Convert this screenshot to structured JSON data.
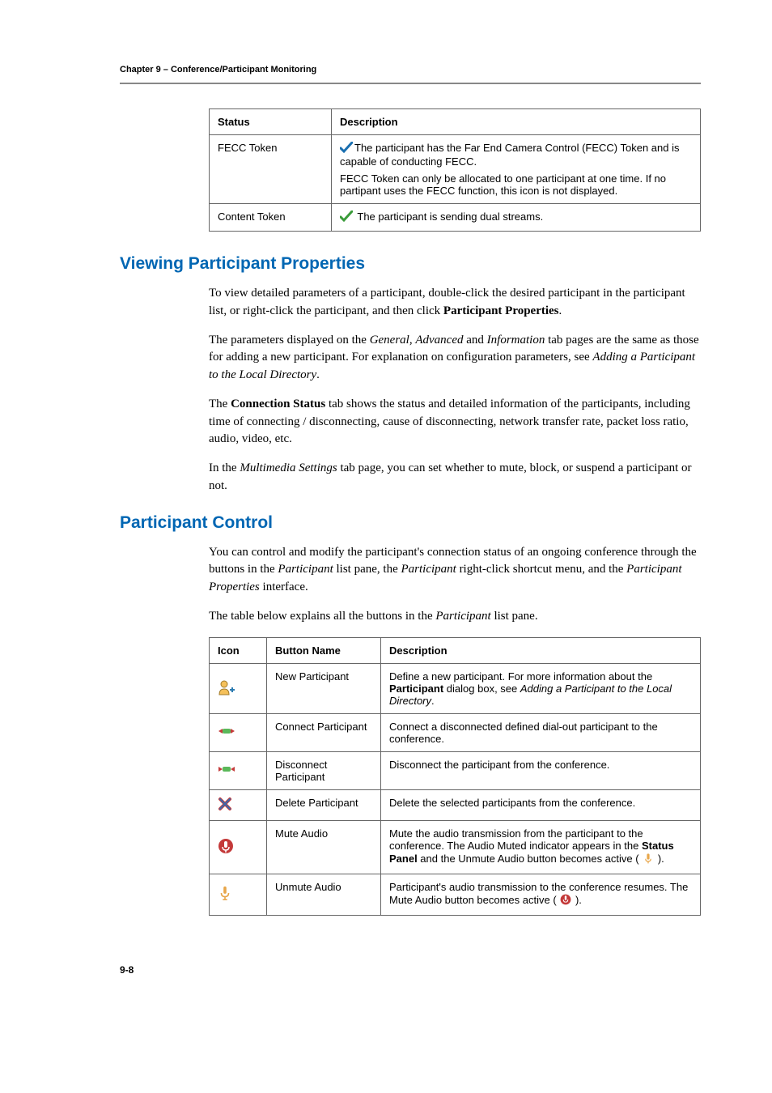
{
  "header": {
    "chapter": "Chapter 9 – Conference/Participant Monitoring"
  },
  "status_table": {
    "headers": [
      "Status",
      "Description"
    ],
    "rows": [
      {
        "status": "FECC Token",
        "line1": "The participant has the Far End Camera Control (FECC) Token and is capable of conducting FECC.",
        "line2": "FECC Token can only be allocated to one participant at one time. If no partipant uses the FECC function, this icon is not displayed."
      },
      {
        "status": "Content Token",
        "line1": "The participant is sending dual streams."
      }
    ]
  },
  "section1": {
    "title": "Viewing Participant Properties",
    "p1a": "To view detailed parameters of a participant, double-click the desired participant in the participant list, or right-click the participant, and then click ",
    "p1b": "Participant Properties",
    "p1c": ".",
    "p2a": "The parameters displayed on the ",
    "p2b": "General",
    "p2c": ", ",
    "p2d": "Advanced",
    "p2e": " and ",
    "p2f": "Information",
    "p2g": " tab pages are the same as those for adding a new participant. For explanation on configuration parameters, see ",
    "p2h": "Adding a Participant to the Local Directory",
    "p2i": ".",
    "p3a": "The ",
    "p3b": "Connection Status",
    "p3c": " tab shows the status and detailed information of the participants, including time of connecting / disconnecting, cause of disconnecting, network transfer rate, packet loss ratio, audio, video, etc.",
    "p4a": "In the ",
    "p4b": "Multimedia Settings",
    "p4c": " tab page, you can set whether to mute, block, or suspend a participant or not."
  },
  "section2": {
    "title": "Participant Control",
    "p1a": "You can control and modify the participant's connection status of an ongoing conference through the buttons in the ",
    "p1b": "Participant",
    "p1c": " list pane, the ",
    "p1d": "Participant",
    "p1e": " right-click shortcut menu, and the ",
    "p1f": "Participant Properties",
    "p1g": " interface.",
    "p2a": "The table below explains all the buttons in the ",
    "p2b": "Participant",
    "p2c": " list pane."
  },
  "buttons_table": {
    "headers": [
      "Icon",
      "Button Name",
      "Description"
    ],
    "rows": [
      {
        "name": "New Participant",
        "desc_a": "Define a new participant. For more information about the ",
        "desc_b": "Participant",
        "desc_c": " dialog box, see ",
        "desc_d": "Adding a Participant to the Local Directory",
        "desc_e": "."
      },
      {
        "name": "Connect Participant",
        "desc": "Connect a disconnected defined dial-out participant to the conference."
      },
      {
        "name": "Disconnect Participant",
        "desc": "Disconnect the participant from the conference."
      },
      {
        "name": "Delete Participant",
        "desc": "Delete the selected participants from the conference."
      },
      {
        "name": "Mute Audio",
        "desc_a": "Mute the audio transmission from the participant to the conference. The Audio Muted indicator appears in the ",
        "desc_b": "Status Panel",
        "desc_c": " and the Unmute Audio button becomes active (",
        "desc_d": ")."
      },
      {
        "name": "Unmute Audio",
        "desc_a": "Participant's audio transmission to the conference resumes. The Mute Audio button becomes active (",
        "desc_b": ")."
      }
    ]
  },
  "footer": {
    "page": "9-8"
  }
}
